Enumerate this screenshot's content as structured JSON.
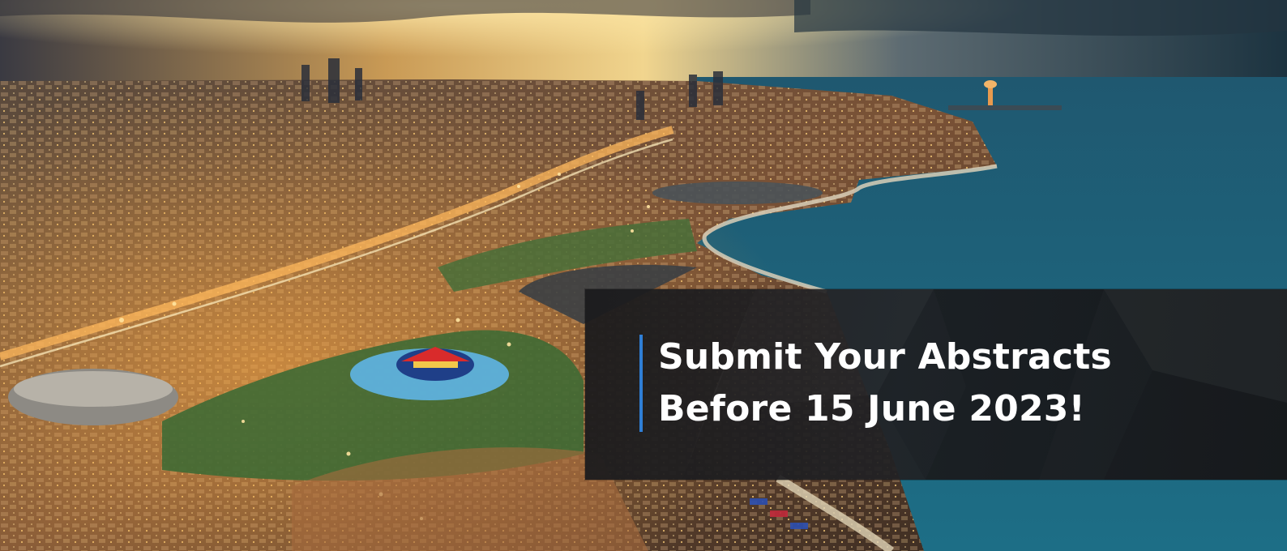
{
  "banner": {
    "headline_line1": "Submit Your Abstracts",
    "headline_line2": "Before 15 June 2023!",
    "accent_color": "#2f7fd6",
    "panel_color": "#1c1c1e"
  },
  "background": {
    "subject": "aerial-city-waterfront-at-dusk"
  }
}
